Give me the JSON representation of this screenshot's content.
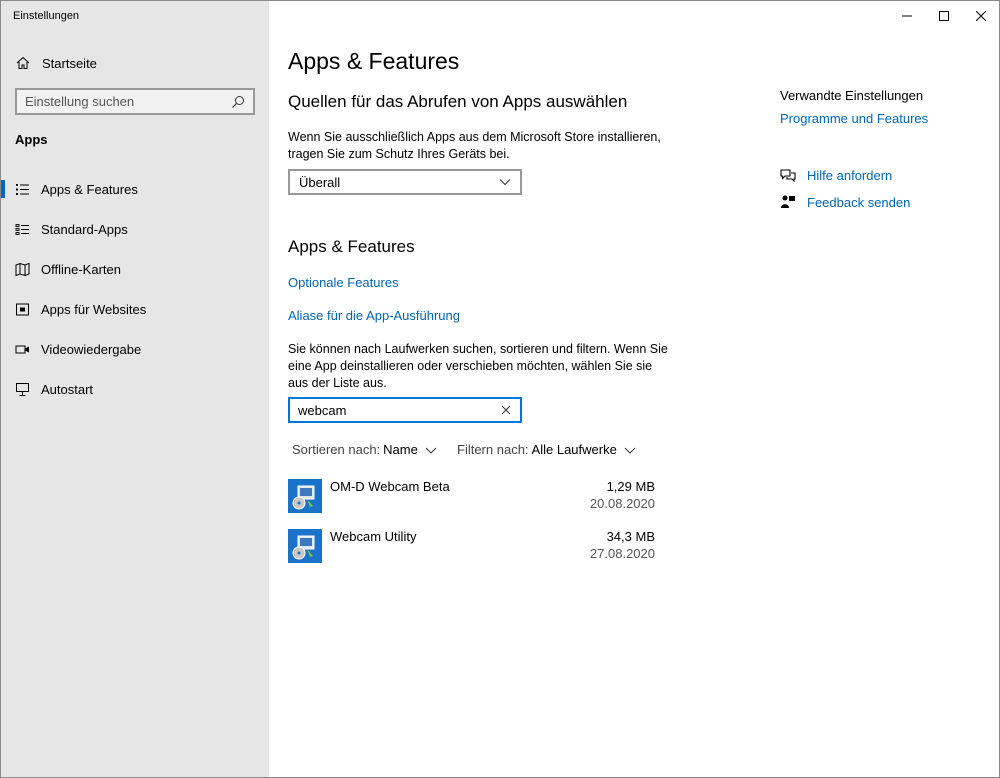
{
  "window": {
    "title": "Einstellungen"
  },
  "sidebar": {
    "home_label": "Startseite",
    "search_placeholder": "Einstellung suchen",
    "section_label": "Apps",
    "items": [
      {
        "label": "Apps & Features",
        "icon": "list-icon",
        "active": true
      },
      {
        "label": "Standard-Apps",
        "icon": "default-apps-icon",
        "active": false
      },
      {
        "label": "Offline-Karten",
        "icon": "map-icon",
        "active": false
      },
      {
        "label": "Apps für Websites",
        "icon": "web-apps-icon",
        "active": false
      },
      {
        "label": "Videowiedergabe",
        "icon": "video-icon",
        "active": false
      },
      {
        "label": "Autostart",
        "icon": "startup-icon",
        "active": false
      }
    ]
  },
  "main": {
    "title": "Apps & Features",
    "source_heading": "Quellen für das Abrufen von Apps auswählen",
    "source_description": "Wenn Sie ausschließlich Apps aus dem Microsoft Store installieren, tragen Sie zum Schutz Ihres Geräts bei.",
    "source_selected": "Überall",
    "apps_heading": "Apps & Features",
    "link_optional": "Optionale Features",
    "link_aliases": "Aliase für die App-Ausführung",
    "search_description": "Sie können nach Laufwerken suchen, sortieren und filtern. Wenn Sie eine App deinstallieren oder verschieben möchten, wählen Sie sie aus der Liste aus.",
    "search_value": "webcam",
    "sort_label": "Sortieren nach:",
    "sort_value": "Name",
    "filter_label": "Filtern nach:",
    "filter_value": "Alle Laufwerke",
    "apps": [
      {
        "name": "OM-D Webcam Beta",
        "size": "1,29 MB",
        "date": "20.08.2020"
      },
      {
        "name": "Webcam Utility",
        "size": "34,3 MB",
        "date": "27.08.2020"
      }
    ]
  },
  "related": {
    "title": "Verwandte Einstellungen",
    "programs_link": "Programme und Features",
    "help_link": "Hilfe anfordern",
    "feedback_link": "Feedback senden"
  },
  "colors": {
    "accent": "#0067c0",
    "link": "#0066b4",
    "sidebar_bg": "#e6e6e6"
  }
}
